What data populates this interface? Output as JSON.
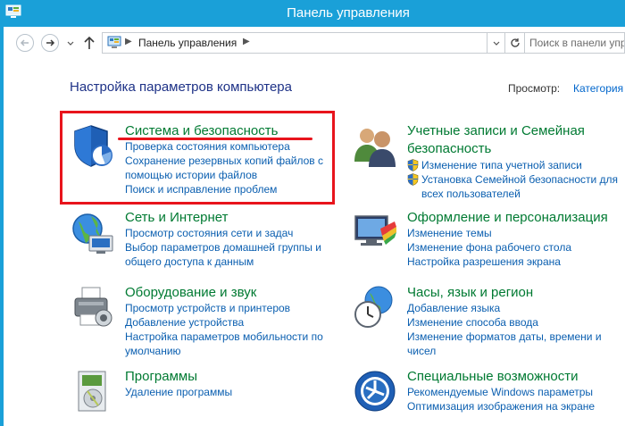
{
  "window": {
    "title": "Панель управления"
  },
  "navigation": {
    "breadcrumb": "Панель управления",
    "search_placeholder": "Поиск в панели упр"
  },
  "page": {
    "title": "Настройка параметров компьютера",
    "view_label": "Просмотр:",
    "view_value": "Категория"
  },
  "categories": [
    {
      "title": "Система и безопасность",
      "icon": "shield-pie-icon",
      "links": [
        "Проверка состояния компьютера",
        "Сохранение резервных копий файлов с",
        "помощью истории файлов",
        "Поиск и исправление проблем"
      ]
    },
    {
      "title": "Сеть и Интернет",
      "icon": "network-globe-icon",
      "links": [
        "Просмотр состояния сети и задач",
        "Выбор параметров домашней группы и",
        "общего доступа к данным"
      ]
    },
    {
      "title": "Оборудование и звук",
      "icon": "printer-icon",
      "links": [
        "Просмотр устройств и принтеров",
        "Добавление устройства",
        "Настройка параметров мобильности по",
        "умолчанию"
      ]
    },
    {
      "title": "Программы",
      "icon": "programs-icon",
      "links": [
        "Удаление программы"
      ]
    },
    {
      "title_line1": "Учетные записи и Семейная",
      "title_line2": "безопасность",
      "icon": "users-icon",
      "links": [
        "Изменение типа учетной записи",
        "Установка Семейной безопасности для",
        "всех пользователей"
      ]
    },
    {
      "title": "Оформление и персонализация",
      "icon": "monitor-palette-icon",
      "links": [
        "Изменение темы",
        "Изменение фона рабочего стола",
        "Настройка разрешения экрана"
      ]
    },
    {
      "title": "Часы, язык и регион",
      "icon": "clock-globe-icon",
      "links": [
        "Добавление языка",
        "Изменение способа ввода",
        "Изменение форматов даты, времени и",
        "чисел"
      ]
    },
    {
      "title": "Специальные возможности",
      "icon": "accessibility-icon",
      "links": [
        "Рекомендуемые Windows параметры",
        "Оптимизация изображения на экране"
      ]
    }
  ],
  "colors": {
    "titlebar": "#1aa0d8",
    "category_title": "#007a32",
    "link": "#0b5fb0",
    "highlight": "#e8141c"
  }
}
